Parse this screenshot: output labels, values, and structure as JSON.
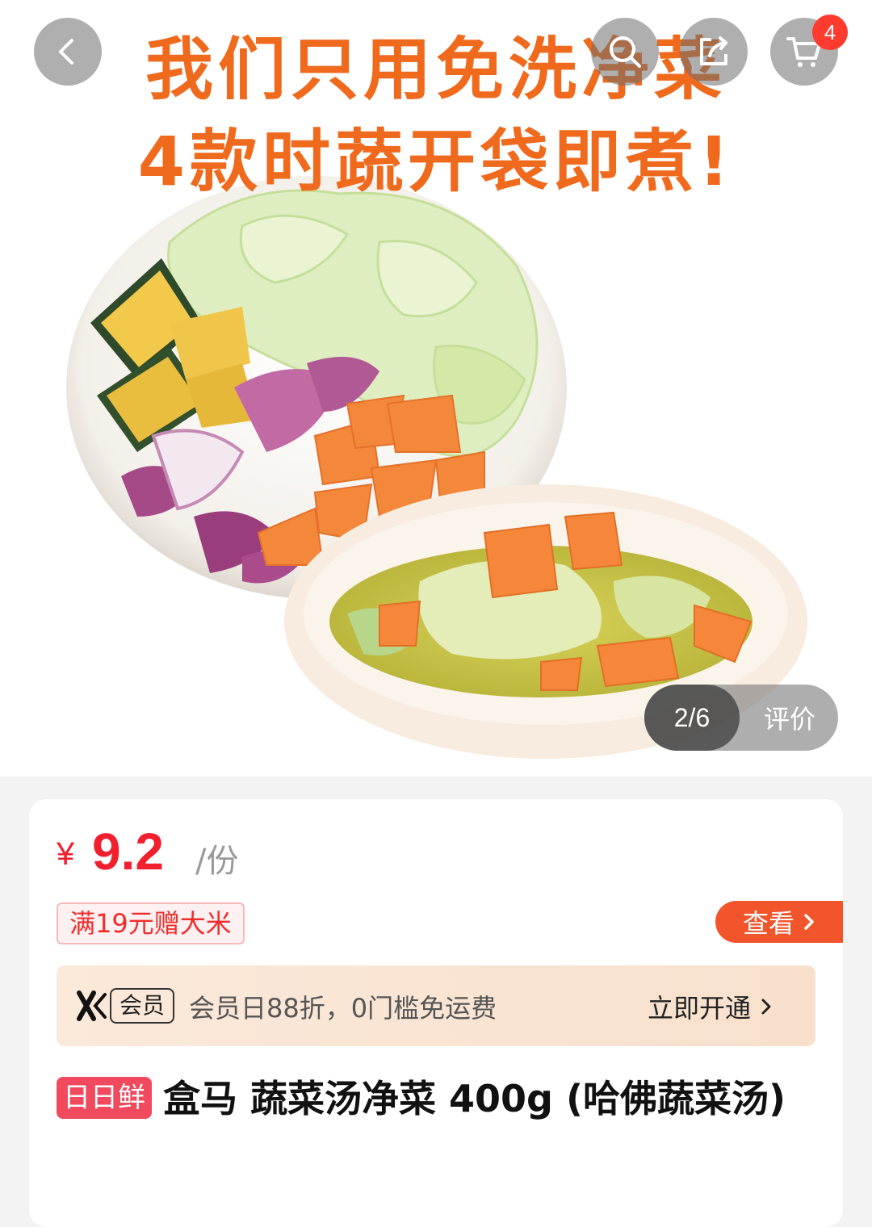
{
  "hero": {
    "headline_line1": "我们只用免洗净菜",
    "headline_line2": "4款时蔬开袋即煮!",
    "gallery_index": "2/6",
    "review_label": "评价"
  },
  "top_bar": {
    "back_icon": "chevron-left-icon",
    "search_icon": "search-icon",
    "share_icon": "share-icon",
    "cart_icon": "cart-icon",
    "cart_count": "4"
  },
  "price": {
    "symbol": "¥",
    "value": "9.2",
    "unit": "/份"
  },
  "promotion": {
    "tag": "满19元赠大米",
    "view_label": "查看"
  },
  "membership": {
    "chip": "会员",
    "description": "会员日88折，0门槛免运费",
    "action": "立即开通"
  },
  "product": {
    "badge": "日日鲜",
    "title": "盒马 蔬菜汤净菜 400g (哈佛蔬菜汤)"
  },
  "colors": {
    "headline": "#f06a1e",
    "price": "#f0202e",
    "view_button": "#f2552c",
    "badge": "#f14a5e"
  }
}
